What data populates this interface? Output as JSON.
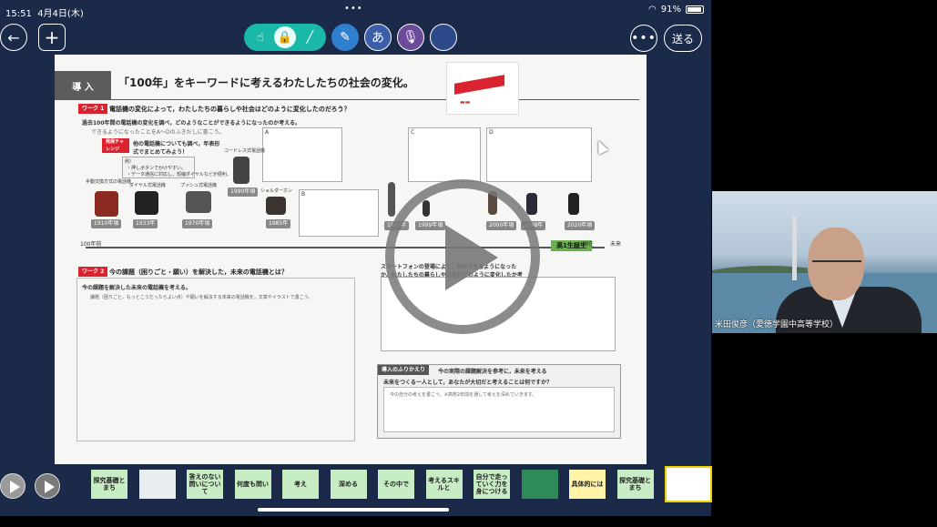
{
  "status_bar": {
    "time": "15:51",
    "date": "4月4日(木)",
    "top_dots": "•••",
    "battery": "91%"
  },
  "toolbar": {
    "back_icon": "←",
    "add_icon": "+",
    "input_icon": "あ",
    "more_icon": "•••",
    "send_label": "送る"
  },
  "document": {
    "section_tag": "導 入",
    "title": "「100年」をキーワードに考えるわたしたちの社会の変化。",
    "work1_tag": "ワーク 1",
    "work1_question": "電話機の変化によって，わたしたちの暮らしや社会はどのように変化したのだろう？",
    "work1_step1": "過去100年間の電話機の変化を調べ，どのようなことができるようになったのか考える。",
    "work1_step1_note": "できるようになったことをA〜Dのふきだしに書こう。",
    "challenge_tag": "発展チャレンジ",
    "challenge_text": "他の電話機についても調べ，年表形式でまとめてみよう！",
    "example_label": "例）",
    "example_line1": "・押しボタンでかけやすい。",
    "example_line2": "・データ通信に対応し，短縮ダイヤルなどが便利。",
    "phones": [
      {
        "label": "手動交換方式の電話機",
        "year": "1910年頃"
      },
      {
        "label": "ダイヤル式電話機",
        "year": "1933年"
      },
      {
        "label": "プッシュ式電話機",
        "year": "1970年頃"
      },
      {
        "label": "コードレス式電話機",
        "year": "1990年頃"
      },
      {
        "label": "ショルダーホン",
        "year": "1985年"
      }
    ],
    "later_phones": [
      {
        "year": "1987年"
      },
      {
        "year": "1999年頃"
      },
      {
        "year": "2000年頃"
      },
      {
        "year": "2008年"
      },
      {
        "year": "2020年頃"
      }
    ],
    "box_labels": [
      "A",
      "B",
      "C",
      "D"
    ],
    "timeline_start": "100年前",
    "timeline_now": "現在",
    "timeline_future": "未来",
    "birth_badge": "高1生誕生",
    "work2_tag": "ワーク 2",
    "work2_question": "今の課題（困りごと・願い）を解決した，未来の電話機とは？",
    "work2_step1": "今の課題を解決した未来の電話機を考える。",
    "work2_step1_note": "課題（困りごと，もっとこうだったらよい点）や願いを解決する未来の電話機を，文章やイラストで書こう。",
    "work2_step2": "スマートフォンの登場により，何ができるようになったか。わたしたちの暮らしや社会がどのように変化したか考える。",
    "reflection_tag": "導入のふりかえり",
    "reflection_text": "今の実際の課題解決を参考に，未来を考える",
    "reflection_question": "未来をつくる一人として，あなたが大切だと考えることは何ですか？",
    "reflection_note": "今の自分の考えを書こう。※高校2年間を通して考えを深めていきます。"
  },
  "thumbnails": [
    {
      "label": "探究基礎とまち",
      "kind": "text"
    },
    {
      "label": "",
      "kind": "img"
    },
    {
      "label": "答えのない問いについて",
      "kind": "text"
    },
    {
      "label": "何度も問い",
      "kind": "text"
    },
    {
      "label": "考え",
      "kind": "text"
    },
    {
      "label": "深める",
      "kind": "text"
    },
    {
      "label": "その中で",
      "kind": "text"
    },
    {
      "label": "考えるスキルと",
      "kind": "text"
    },
    {
      "label": "自分で走っていく力を身につける",
      "kind": "text"
    },
    {
      "label": "",
      "kind": "green"
    },
    {
      "label": "具体的には",
      "kind": "yellow"
    },
    {
      "label": "探究基礎とまち",
      "kind": "text"
    },
    {
      "label": "",
      "kind": "sel"
    }
  ],
  "video": {
    "caption": "米田俊彦（愛徳学園中高等学校）"
  },
  "colors": {
    "accent_teal": "#19b8a8",
    "app_bg": "#1c2a4a",
    "doc_red": "#d9232e"
  }
}
